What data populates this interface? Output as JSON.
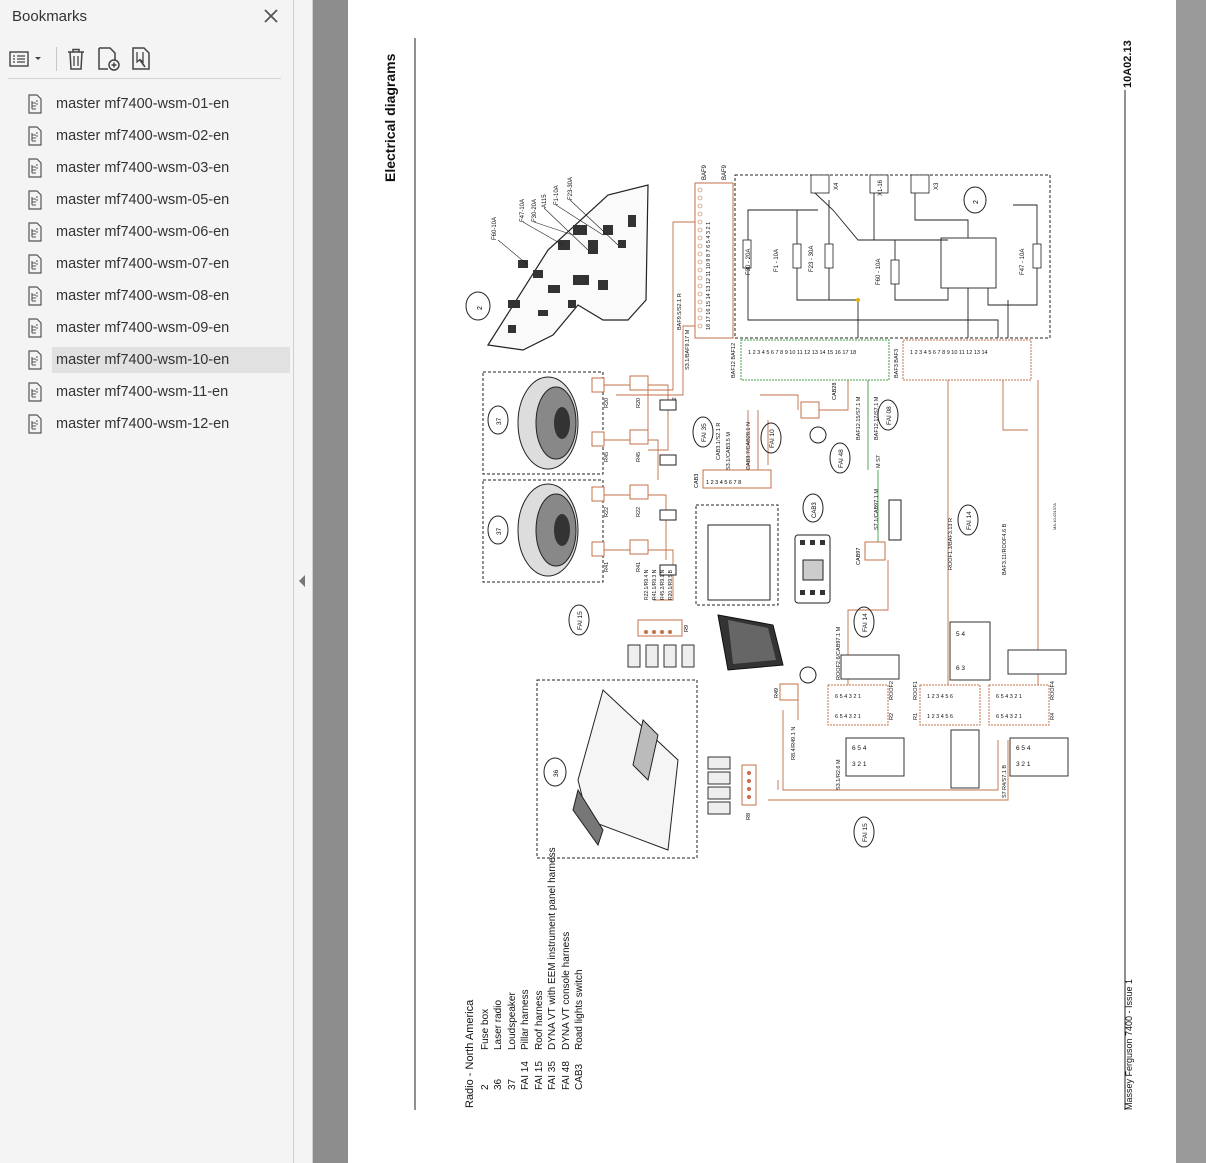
{
  "sidebar": {
    "title": "Bookmarks",
    "items": [
      {
        "label": "master mf7400-wsm-01-en"
      },
      {
        "label": "master mf7400-wsm-02-en"
      },
      {
        "label": "master mf7400-wsm-03-en"
      },
      {
        "label": "master mf7400-wsm-05-en"
      },
      {
        "label": "master mf7400-wsm-06-en"
      },
      {
        "label": "master mf7400-wsm-07-en"
      },
      {
        "label": "master mf7400-wsm-08-en"
      },
      {
        "label": "master mf7400-wsm-09-en"
      },
      {
        "label": "master mf7400-wsm-10-en",
        "selected": true
      },
      {
        "label": "master mf7400-wsm-11-en"
      },
      {
        "label": "master mf7400-wsm-12-en"
      }
    ]
  },
  "toolbar": {
    "icons": [
      "bookmark-options-icon",
      "delete-icon",
      "add-bookmark-icon",
      "find-bookmark-icon"
    ]
  },
  "document": {
    "section_title": "Electrical diagrams",
    "page_code": "10A02.13",
    "footer": "Massey Ferguson 7400 - Issue 1",
    "legend_title": "Radio - North America",
    "legend": [
      {
        "code": "2",
        "desc": "Fuse box"
      },
      {
        "code": "36",
        "desc": "Laser radio"
      },
      {
        "code": "37",
        "desc": "Loudspeaker"
      },
      {
        "code": "FAI 14",
        "desc": "Pillar harness"
      },
      {
        "code": "FAI 15",
        "desc": "Roof harness"
      },
      {
        "code": "FAI 35",
        "desc": "DYNA VT with EEM instrument panel harness"
      },
      {
        "code": "FAI 48",
        "desc": "DYNA VT console harness"
      },
      {
        "code": "CAB3",
        "desc": "Road lights switch"
      }
    ],
    "diagram_labels": {
      "fuses": [
        "F60-10A",
        "F47-10A",
        "F30-20A",
        "A115",
        "F1-10A",
        "F23-30A"
      ],
      "fusebox_fuses": [
        "F30 - 20A",
        "F1 - 10A",
        "F23 - 30A",
        "F60 - 10A",
        "F47 - 10A"
      ],
      "harness_tags": [
        "FAI 15",
        "FAI 35",
        "FAI 10",
        "FAI 48",
        "FAI 08",
        "FAI 14",
        "FAI 15"
      ],
      "connectors": [
        "BAF9",
        "BAF12",
        "BAF3",
        "CAB3",
        "CAB97",
        "ROOF1",
        "ROOF2",
        "ROOF4",
        "R1",
        "R2",
        "R4",
        "R8",
        "R9",
        "R49",
        "CAB28"
      ],
      "components": [
        "2",
        "37",
        "37",
        "36",
        "CAB3",
        "2"
      ],
      "speaker_pins": [
        "R20",
        "R20",
        "R45",
        "R45",
        "R22",
        "R22",
        "R41",
        "R41"
      ],
      "relays": [
        "X4",
        "X1-16",
        "X3"
      ],
      "wire_labels": [
        "BAF9.5/S2.1",
        "S3.1/BAF9.17",
        "S2",
        "CAB3.1/S2.1",
        "S3.1/CAB3.5",
        "CAB3.7/CAB28.1",
        "BAF12.15/S7.1",
        "BAF12.17/S7.1",
        "M",
        "R",
        "N",
        "B",
        "S7.1/CAB97.1",
        "ROOF2.6/CAB97.1",
        "ROOF1.3/BAF3.13",
        "BAF3.11/ROOF4.6",
        "R8.4/R49.1",
        "S3.1/R2.6",
        "R4/S7.1",
        "S7"
      ],
      "drawing_ref": "MA-10-02137A"
    }
  }
}
